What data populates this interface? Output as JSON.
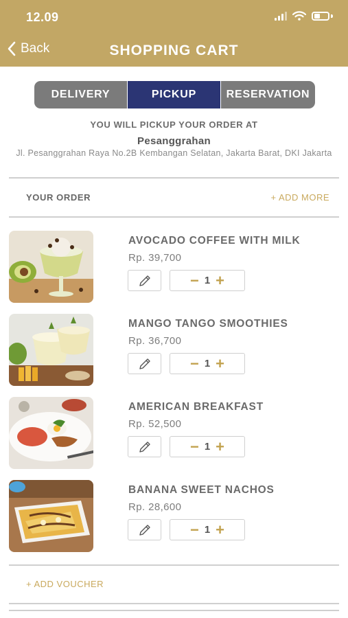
{
  "status_bar": {
    "time": "12.09"
  },
  "header": {
    "back_label": "Back",
    "title": "SHOPPING CART"
  },
  "tabs": [
    {
      "label": "DELIVERY",
      "active": false
    },
    {
      "label": "PICKUP",
      "active": true
    },
    {
      "label": "RESERVATION",
      "active": false
    }
  ],
  "pickup": {
    "label": "YOU WILL PICKUP YOUR ORDER AT",
    "store_name": "Pesanggrahan",
    "address": "Jl. Pesanggrahan Raya No.2B Kembangan Selatan, Jakarta Barat, DKI Jakarta"
  },
  "order": {
    "heading": "YOUR ORDER",
    "add_more": "+ ADD MORE"
  },
  "items": [
    {
      "name": "AVOCADO COFFEE WITH MILK",
      "price": "Rp. 39,700",
      "qty": "1"
    },
    {
      "name": "MANGO TANGO SMOOTHIES",
      "price": "Rp. 36,700",
      "qty": "1"
    },
    {
      "name": "AMERICAN BREAKFAST",
      "price": "Rp. 52,500",
      "qty": "1"
    },
    {
      "name": "BANANA SWEET NACHOS",
      "price": "Rp. 28,600",
      "qty": "1"
    }
  ],
  "voucher": {
    "label": "+ ADD VOUCHER"
  },
  "colors": {
    "header": "#c2a765",
    "active_tab": "#2b3574",
    "inactive_tab": "#7b7b7b",
    "accent": "#c9a95d"
  }
}
